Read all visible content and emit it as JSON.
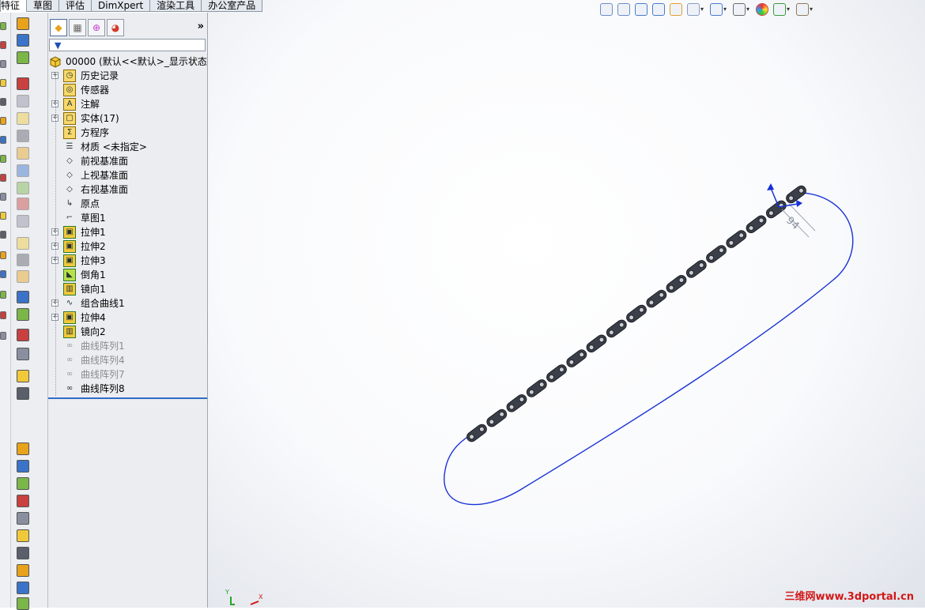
{
  "command_tabs": [
    {
      "label": "特征",
      "active": true
    },
    {
      "label": "草图",
      "active": false
    },
    {
      "label": "评估",
      "active": false
    },
    {
      "label": "DimXpert",
      "active": false
    },
    {
      "label": "渲染工具",
      "active": false
    },
    {
      "label": "办公室产品",
      "active": false
    }
  ],
  "panel": {
    "tabs": [
      {
        "icon": "feature-manager-icon"
      },
      {
        "icon": "property-manager-icon"
      },
      {
        "icon": "configuration-manager-icon"
      },
      {
        "icon": "display-manager-icon"
      }
    ],
    "expand_label": "»",
    "filter_icon": "filter-icon"
  },
  "tree": {
    "root": {
      "label": "00000  (默认<<默认>_显示状态",
      "icon": "part-icon"
    },
    "items": [
      {
        "label": "历史记录",
        "icon": "history-folder-icon",
        "expandable": true,
        "dim": false
      },
      {
        "label": "传感器",
        "icon": "sensor-folder-icon",
        "expandable": false,
        "dim": false
      },
      {
        "label": "注解",
        "icon": "annotation-icon",
        "expandable": true,
        "dim": false
      },
      {
        "label": "实体(17)",
        "icon": "solid-bodies-folder-icon",
        "expandable": true,
        "dim": false
      },
      {
        "label": "方程序",
        "icon": "equations-folder-icon",
        "expandable": false,
        "dim": false
      },
      {
        "label": "材质 <未指定>",
        "icon": "material-icon",
        "expandable": false,
        "dim": false
      },
      {
        "label": "前视基准面",
        "icon": "plane-icon",
        "expandable": false,
        "dim": false
      },
      {
        "label": "上视基准面",
        "icon": "plane-icon",
        "expandable": false,
        "dim": false
      },
      {
        "label": "右视基准面",
        "icon": "plane-icon",
        "expandable": false,
        "dim": false
      },
      {
        "label": "原点",
        "icon": "origin-icon",
        "expandable": false,
        "dim": false
      },
      {
        "label": "草图1",
        "icon": "sketch-icon",
        "expandable": false,
        "dim": false
      },
      {
        "label": "拉伸1",
        "icon": "extrude-icon",
        "expandable": true,
        "dim": false
      },
      {
        "label": "拉伸2",
        "icon": "extrude-icon",
        "expandable": true,
        "dim": false
      },
      {
        "label": "拉伸3",
        "icon": "extrude-icon",
        "expandable": true,
        "dim": false
      },
      {
        "label": "倒角1",
        "icon": "chamfer-icon",
        "expandable": false,
        "dim": false
      },
      {
        "label": "镜向1",
        "icon": "mirror-icon",
        "expandable": false,
        "dim": false
      },
      {
        "label": "组合曲线1",
        "icon": "composite-curve-icon",
        "expandable": true,
        "dim": false
      },
      {
        "label": "拉伸4",
        "icon": "extrude-icon",
        "expandable": true,
        "dim": false
      },
      {
        "label": "镜向2",
        "icon": "mirror-icon",
        "expandable": false,
        "dim": false
      },
      {
        "label": "曲线阵列1",
        "icon": "curve-pattern-icon",
        "expandable": false,
        "dim": true
      },
      {
        "label": "曲线阵列4",
        "icon": "curve-pattern-icon",
        "expandable": false,
        "dim": true
      },
      {
        "label": "曲线阵列7",
        "icon": "curve-pattern-icon",
        "expandable": false,
        "dim": true
      },
      {
        "label": "曲线阵列8",
        "icon": "curve-pattern-icon",
        "expandable": false,
        "dim": false
      }
    ]
  },
  "viewport": {
    "toolbar": [
      {
        "icon": "zoom-to-fit-icon",
        "dropdown": false
      },
      {
        "icon": "zoom-to-area-icon",
        "dropdown": false
      },
      {
        "icon": "previous-view-icon",
        "dropdown": false
      },
      {
        "icon": "section-view-icon",
        "dropdown": false
      },
      {
        "icon": "dynamic-annotation-view-icon",
        "dropdown": false
      },
      {
        "icon": "view-orientation-icon",
        "dropdown": true
      },
      {
        "icon": "display-style-icon",
        "dropdown": true
      },
      {
        "icon": "hide-show-items-icon",
        "dropdown": true
      },
      {
        "icon": "edit-appearance-icon",
        "dropdown": false
      },
      {
        "icon": "apply-scene-icon",
        "dropdown": true
      },
      {
        "icon": "view-settings-icon",
        "dropdown": true
      }
    ],
    "dimension_label": "94",
    "triad": {
      "x_label": "X",
      "y_label": "Y"
    },
    "watermark": "三维网www.3dportal.cn",
    "path_color": "#1a33d6",
    "link_color": "#3a3f4a"
  }
}
